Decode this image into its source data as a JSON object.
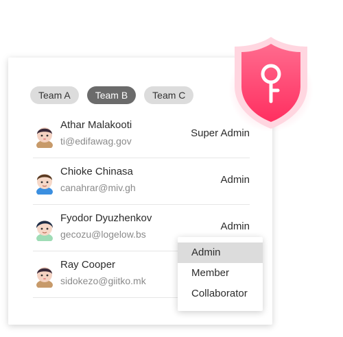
{
  "tabs": [
    {
      "label": "Team A",
      "active": false
    },
    {
      "label": "Team B",
      "active": true
    },
    {
      "label": "Team C",
      "active": false
    }
  ],
  "users": [
    {
      "name": "Athar Malakooti",
      "email": "ti@edifawag.gov",
      "role": "Super Admin"
    },
    {
      "name": "Chioke Chinasa",
      "email": "canahrar@miv.gh",
      "role": "Admin"
    },
    {
      "name": "Fyodor Dyuzhenkov",
      "email": "gecozu@logelow.bs",
      "role": "Admin"
    },
    {
      "name": "Ray Cooper",
      "email": "sidokezo@giitko.mk",
      "role": ""
    }
  ],
  "role_menu": {
    "options": [
      "Admin",
      "Member",
      "Collaborator"
    ],
    "selected": "Admin"
  },
  "colors": {
    "accent": "#ff4d7a",
    "chip_active": "#6b6b6b",
    "chip_inactive": "#dcdcdc"
  },
  "icons": [
    "shield-key-icon",
    "avatar"
  ]
}
